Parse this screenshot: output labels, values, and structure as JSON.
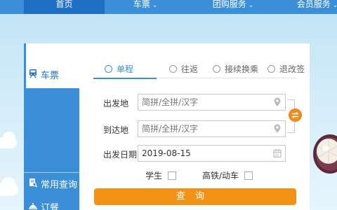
{
  "nav": {
    "home": "首页",
    "tickets": "车票",
    "group": "团购服务",
    "member": "会员服务"
  },
  "sidebar": {
    "items": [
      {
        "label": "车票"
      },
      {
        "label": "常用查询"
      },
      {
        "label": "订餐"
      }
    ]
  },
  "tabs": [
    {
      "label": "单程"
    },
    {
      "label": "往返"
    },
    {
      "label": "接续换乘"
    },
    {
      "label": "退改签"
    }
  ],
  "form": {
    "from_label": "出发地",
    "from_placeholder": "简拼/全拼/汉字",
    "to_label": "到达地",
    "to_placeholder": "简拼/全拼/汉字",
    "date_label": "出发日期",
    "date_value": "2019-08-15",
    "student_label": "学生",
    "hsr_label": "高铁/动车",
    "search_label": "查询"
  },
  "colors": {
    "primary": "#3b8fd8",
    "primary_dark": "#1f6fc4",
    "accent": "#f29318"
  }
}
